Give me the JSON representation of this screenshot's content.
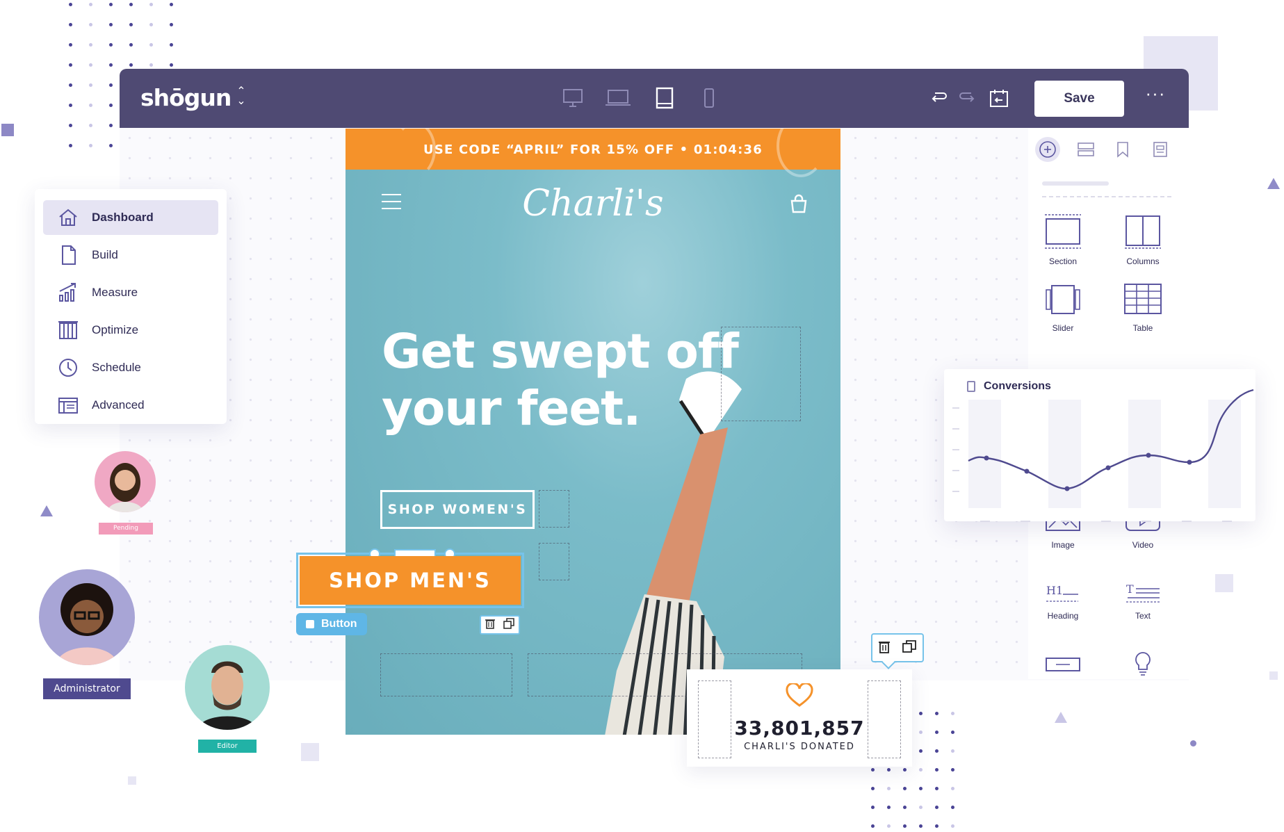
{
  "app": {
    "logo": "shōgun"
  },
  "toolbar": {
    "save_label": "Save",
    "more_label": "···"
  },
  "preview": {
    "promo_text": "USE CODE “APRIL” FOR 15% OFF • 01:04:36",
    "brand": "Charli's",
    "hero_line1": "Get swept off",
    "hero_line2": "your feet.",
    "shop_women_label": "SHOP WOMEN'S",
    "shop_men_label": "SHOP MEN'S",
    "selected_tag": "Button"
  },
  "nav": {
    "items": [
      {
        "label": "Dashboard",
        "icon": "home-icon"
      },
      {
        "label": "Build",
        "icon": "document-icon"
      },
      {
        "label": "Measure",
        "icon": "chart-up-icon"
      },
      {
        "label": "Optimize",
        "icon": "flask-icon"
      },
      {
        "label": "Schedule",
        "icon": "clock-icon"
      },
      {
        "label": "Advanced",
        "icon": "list-icon"
      }
    ]
  },
  "users": {
    "pending": "Pending",
    "administrator": "Administrator",
    "editor": "Editor"
  },
  "components": {
    "section": "Section",
    "columns": "Columns",
    "slider": "Slider",
    "table": "Table",
    "image": "Image",
    "video": "Video",
    "heading": "Heading",
    "text": "Text"
  },
  "conversions": {
    "title": "Conversions"
  },
  "donation": {
    "value": "33,801,857",
    "label": "CHARLI'S DONATED"
  },
  "colors": {
    "toolbar": "#4f4a73",
    "accent_orange": "#f5922a",
    "preview_sky": "#6fb4c2",
    "selection_blue": "#76c3ea",
    "ink": "#2f2b55"
  }
}
